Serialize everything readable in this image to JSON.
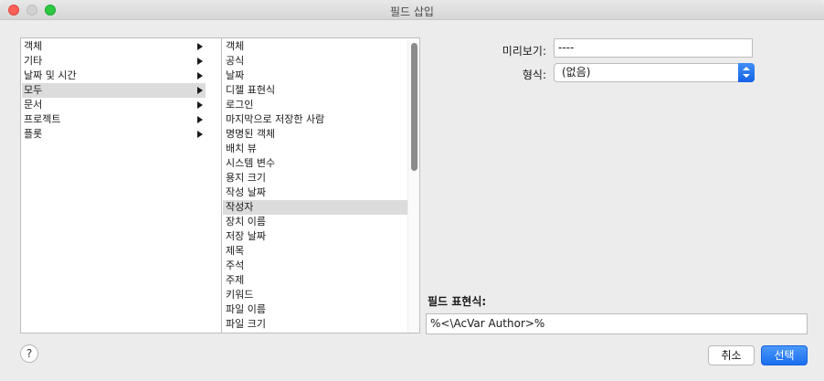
{
  "window": {
    "title": "필드 삽입"
  },
  "categories": {
    "items": [
      {
        "label": "객체",
        "has_submenu": true
      },
      {
        "label": "기타",
        "has_submenu": true
      },
      {
        "label": "날짜 및 시간",
        "has_submenu": true
      },
      {
        "label": "모두",
        "has_submenu": true,
        "selected": true
      },
      {
        "label": "문서",
        "has_submenu": true
      },
      {
        "label": "프로젝트",
        "has_submenu": true
      },
      {
        "label": "플롯",
        "has_submenu": true
      }
    ]
  },
  "fields": {
    "items": [
      "객체",
      "공식",
      "날짜",
      "디젤 표현식",
      "로그인",
      "마지막으로 저장한 사람",
      "명명된 객체",
      "배치 뷰",
      "시스템 변수",
      "용지 크기",
      "작성 날짜",
      "작성자",
      "장치 이름",
      "저장 날짜",
      "제목",
      "주석",
      "주제",
      "키워드",
      "파일 이름",
      "파일 크기"
    ],
    "selected_index": 11
  },
  "preview": {
    "label": "미리보기:",
    "value": "----"
  },
  "format": {
    "label": "형식:",
    "selected": "(없음)"
  },
  "expression": {
    "label": "필드 표현식:",
    "value": "%<\\AcVar Author>%"
  },
  "buttons": {
    "help": "?",
    "cancel": "취소",
    "select": "선택"
  },
  "colors": {
    "accent": "#1a6ef0",
    "selection": "#dcdcdc"
  }
}
